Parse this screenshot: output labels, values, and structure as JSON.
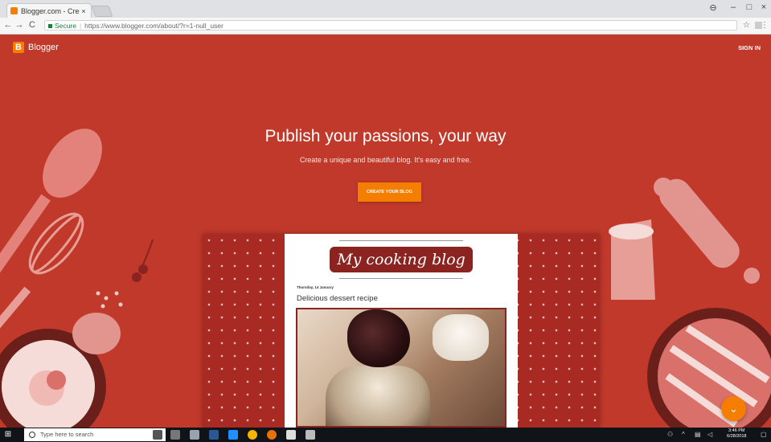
{
  "browser": {
    "tab_title": "Blogger.com - Create a u...",
    "tab_close": "×",
    "window_controls": [
      "⊖",
      "–",
      "□",
      "×"
    ],
    "nav": {
      "back": "←",
      "forward": "→",
      "reload": "C"
    },
    "secure_label": "Secure",
    "url": "https://www.blogger.com/about/?r=1-null_user",
    "bookmark": "☆",
    "menu": "⋮"
  },
  "page": {
    "brand": "Blogger",
    "brand_letter": "B",
    "signin": "SIGN IN",
    "headline": "Publish your passions, your way",
    "subheadline": "Create a unique and beautiful blog. It's easy and free.",
    "cta": "CREATE YOUR BLOG",
    "scroll_icon": "⌄"
  },
  "preview": {
    "blog_title": "My cooking blog",
    "post_date": "Thursday, 14 January",
    "post_title": "Delicious dessert recipe"
  },
  "taskbar": {
    "search_placeholder": "Type here to search",
    "time": "3:46 PM",
    "date": "6/28/2018"
  },
  "colors": {
    "background": "#c0392b",
    "brand_orange": "#f57d00",
    "dark_red": "#8b2420"
  }
}
